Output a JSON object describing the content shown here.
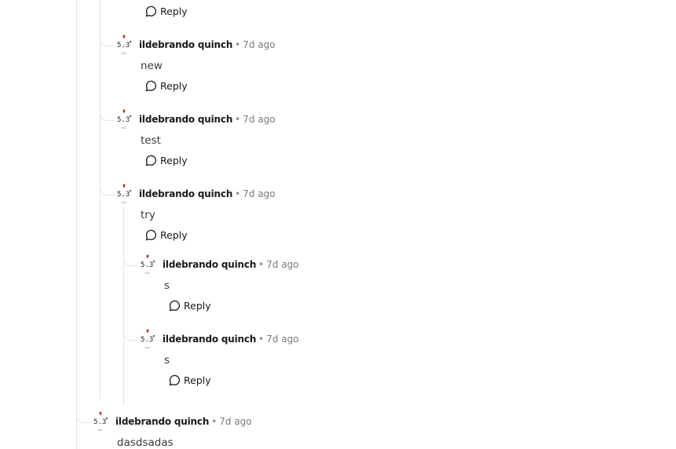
{
  "reply_label": "Reply",
  "separator": "•",
  "top_reply_label": "Reply",
  "comments": [
    {
      "author": "ildebrando quinch",
      "time": "7d ago",
      "text": "new",
      "reply_label": "Reply"
    },
    {
      "author": "ildebrando quinch",
      "time": "7d ago",
      "text": "test",
      "reply_label": "Reply"
    },
    {
      "author": "ildebrando quinch",
      "time": "7d ago",
      "text": "try",
      "reply_label": "Reply",
      "replies": [
        {
          "author": "ildebrando quinch",
          "time": "7d ago",
          "text": "s",
          "reply_label": "Reply"
        },
        {
          "author": "ildebrando quinch",
          "time": "7d ago",
          "text": "s",
          "reply_label": "Reply"
        }
      ]
    }
  ],
  "root_comment": {
    "author": "ildebrando quinch",
    "time": "7d ago",
    "text": "dasdsadas"
  },
  "icons": {
    "reply": "speech-bubble-icon",
    "avatar": "avatar-doodle"
  }
}
